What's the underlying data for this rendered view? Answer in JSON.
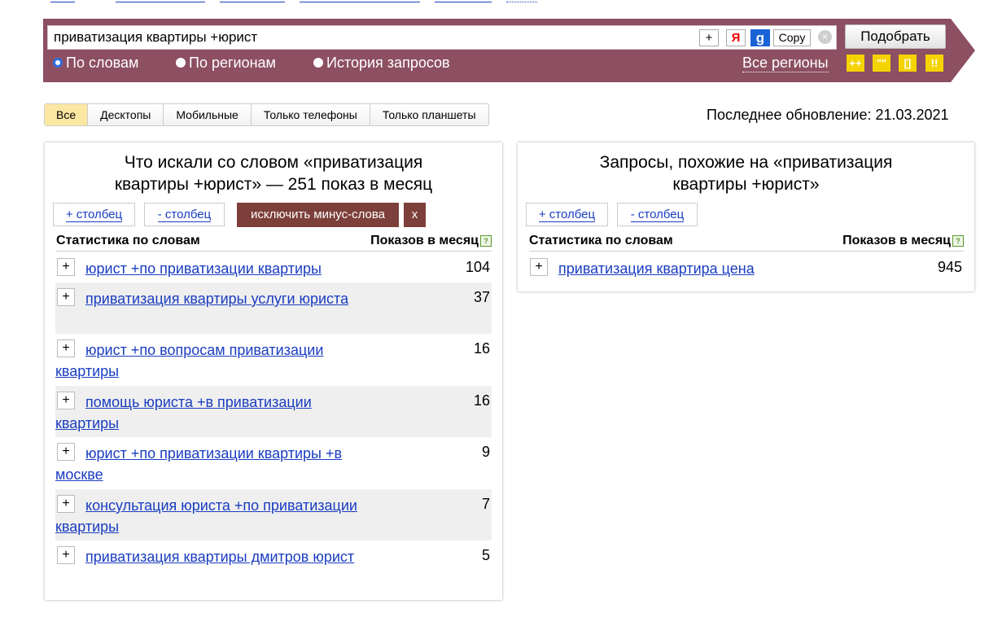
{
  "search": {
    "query": "приватизация квартиры +юрист",
    "plus_tool": "+",
    "yandex_tool": "Я",
    "google_tool": "g",
    "copy_tool": "Copy",
    "clear_tool": "×",
    "submit_label": "Подобрать",
    "modes": [
      {
        "label": "По словам",
        "selected": true
      },
      {
        "label": "По регионам",
        "selected": false
      },
      {
        "label": "История запросов",
        "selected": false
      }
    ],
    "regions_label": "Все регионы",
    "operators": [
      "++",
      "\"\"",
      "[]",
      "!!"
    ]
  },
  "device_tabs": [
    {
      "label": "Все",
      "active": true
    },
    {
      "label": "Десктопы",
      "active": false
    },
    {
      "label": "Мобильные",
      "active": false
    },
    {
      "label": "Только телефоны",
      "active": false
    },
    {
      "label": "Только планшеты",
      "active": false
    }
  ],
  "last_update": "Последнее обновление: 21.03.2021",
  "left_panel": {
    "title_line1": "Что искали со словом «приватизация",
    "title_line2_pre": "квартиры +юрист» — ",
    "count": "251",
    "title_line2_post": " показ в месяц",
    "add_column": "+ столбец",
    "remove_column": "- столбец",
    "exclude_minus": "исключить минус-слова",
    "close": "x",
    "col_words": "Статистика по словам",
    "col_shows": "Показов в месяц",
    "help_icon": "?",
    "rows": [
      {
        "phrase": "юрист +по приватизации квартиры",
        "shows": "104"
      },
      {
        "phrase": "приватизация квартиры услуги юриста",
        "shows": "37"
      },
      {
        "phrase": "юрист +по вопросам приватизации квартиры",
        "shows": "16"
      },
      {
        "phrase": "помощь юриста +в приватизации квартиры",
        "shows": "16"
      },
      {
        "phrase": "юрист +по приватизации квартиры +в москве",
        "shows": "9"
      },
      {
        "phrase": "консультация юриста +по приватизации квартиры",
        "shows": "7"
      },
      {
        "phrase": "приватизация квартиры дмитров юрист",
        "shows": "5"
      }
    ]
  },
  "right_panel": {
    "title_line1": "Запросы, похожие на «приватизация",
    "title_line2": "квартиры +юрист»",
    "add_column": "+ столбец",
    "remove_column": "- столбец",
    "col_words": "Статистика по словам",
    "col_shows": "Показов в месяц",
    "help_icon": "?",
    "rows": [
      {
        "phrase": "приватизация квартира цена",
        "shows": "945"
      }
    ]
  },
  "plus_label": "+",
  "colors": {
    "banner": "#8d4f62",
    "link": "#1a3dc1",
    "active_tab": "#fce7a3",
    "operator": "#f5d300",
    "exclude_button": "#7d3f3a"
  }
}
